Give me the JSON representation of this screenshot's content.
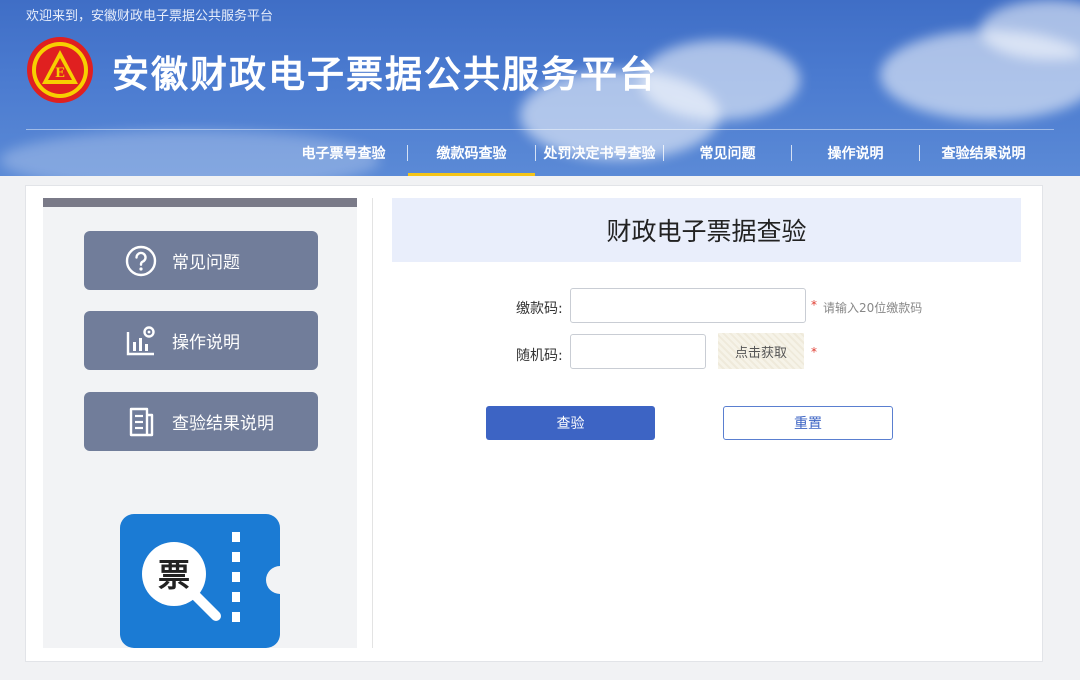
{
  "header": {
    "welcome": "欢迎来到，安徽财政电子票据公共服务平台",
    "title": "安徽财政电子票据公共服务平台",
    "logo_text": "E"
  },
  "nav": {
    "items": [
      {
        "label": "电子票号查验"
      },
      {
        "label": "缴款码查验",
        "active": true
      },
      {
        "label": "处罚决定书号查验"
      },
      {
        "label": "常见问题"
      },
      {
        "label": "操作说明"
      },
      {
        "label": "查验结果说明"
      }
    ]
  },
  "sidebar": {
    "items": [
      {
        "label": "常见问题",
        "icon": "question-icon"
      },
      {
        "label": "操作说明",
        "icon": "chart-gear-icon"
      },
      {
        "label": "查验结果说明",
        "icon": "document-icon"
      }
    ],
    "ticket_char": "票"
  },
  "form": {
    "heading": "财政电子票据查验",
    "payment_code_label": "缴款码:",
    "payment_code_value": "",
    "payment_code_hint": "请输入20位缴款码",
    "required_mark": "*",
    "captcha_label": "随机码:",
    "captcha_value": "",
    "captcha_button": "点击获取",
    "submit_label": "查验",
    "reset_label": "重置"
  },
  "colors": {
    "header_blue": "#4b7bd0",
    "nav_active_underline": "#f5c518",
    "sidebar_button": "#717d9a",
    "primary_button": "#3d64c4"
  }
}
